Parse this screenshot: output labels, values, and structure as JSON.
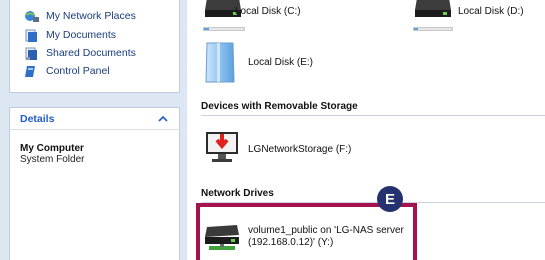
{
  "places": {
    "items": [
      {
        "label": "My Network Places",
        "icon": "network-places-icon"
      },
      {
        "label": "My Documents",
        "icon": "documents-folder-icon"
      },
      {
        "label": "Shared Documents",
        "icon": "shared-folder-icon"
      },
      {
        "label": "Control Panel",
        "icon": "control-panel-icon"
      }
    ]
  },
  "details": {
    "header": "Details",
    "title": "My Computer",
    "subtitle": "System Folder"
  },
  "hard_disks": [
    {
      "label": "Local Disk (C:)",
      "icon": "hard-drive-icon",
      "capacity_fraction": 0.12
    },
    {
      "label": "Local Disk (D:)",
      "icon": "hard-drive-icon",
      "capacity_fraction": 0.1
    },
    {
      "label": "Local Disk (E:)",
      "icon": "blank-disk-icon"
    }
  ],
  "removable_section": {
    "heading": "Devices with Removable Storage",
    "device_label": "LGNetworkStorage (F:)",
    "device_icon": "removable-storage-icon"
  },
  "network_section": {
    "heading": "Network Drives",
    "drive_label_line1": "volume1_public on 'LG-NAS server",
    "drive_label_line2": "(192.168.0.12)' (Y:)",
    "drive_icon": "network-drive-icon"
  },
  "callout": {
    "badge": "E",
    "color": "#a5124e",
    "badge_color": "#26326f"
  }
}
